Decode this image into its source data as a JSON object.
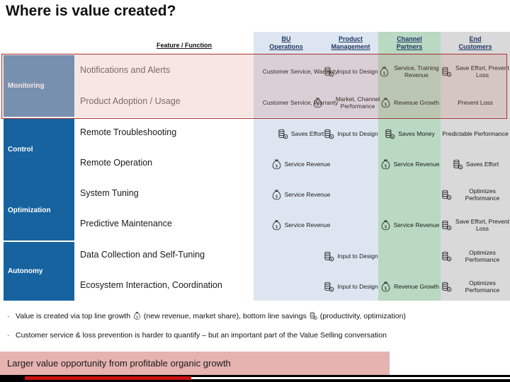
{
  "title": "Where is value created?",
  "feature_column_header": "Feature / Function",
  "columns": [
    {
      "id": "bu",
      "label": "BU\nOperations",
      "label_l1": "BU",
      "label_l2": "Operations",
      "color": "#dde6f0"
    },
    {
      "id": "pm",
      "label": "Product\nManagement",
      "label_l1": "Product",
      "label_l2": "Management",
      "color": "#dde6f0"
    },
    {
      "id": "cp",
      "label": "Channel\nPartners",
      "label_l1": "Channel",
      "label_l2": "Partners",
      "color": "#b9d9c2"
    },
    {
      "id": "ec",
      "label": "End\nCustomers",
      "label_l1": "End",
      "label_l2": "Customers",
      "color": "#d9d9d9"
    }
  ],
  "stages": [
    {
      "label": "Monitoring",
      "color": "#1663a0"
    },
    {
      "label": "Control",
      "color": "#1663a0"
    },
    {
      "label": "Optimization",
      "color": "#1663a0"
    },
    {
      "label": "Autonomy",
      "color": "#1663a0"
    }
  ],
  "rows": [
    {
      "feature": "Notifications and Alerts",
      "cells": [
        {
          "col": "bu",
          "icon": "none",
          "text": "Customer Service, Warranty"
        },
        {
          "col": "pm",
          "icon": "coins-icon",
          "text": "Input to Design"
        },
        {
          "col": "cp",
          "icon": "moneybag-icon",
          "text": "Service, Training Revenue"
        },
        {
          "col": "ec",
          "icon": "coins-icon",
          "text": "Save Effort, Prevent Loss"
        }
      ]
    },
    {
      "feature": "Product Adoption / Usage",
      "cells": [
        {
          "col": "bu",
          "icon": "none",
          "text": "Customer Service, Warranty"
        },
        {
          "col": "pm",
          "icon": "moneybag-icon",
          "text": "Market, Channel Performance"
        },
        {
          "col": "cp",
          "icon": "moneybag-icon",
          "text": "Revenue Growth"
        },
        {
          "col": "ec",
          "icon": "none",
          "text": "Prevent Loss"
        }
      ]
    },
    {
      "feature": "Remote Troubleshooting",
      "cells": [
        {
          "col": "bu",
          "icon": "coins-icon",
          "text": "Saves Effort"
        },
        {
          "col": "pm",
          "icon": "coins-icon",
          "text": "Input to Design"
        },
        {
          "col": "cp",
          "icon": "coins-icon",
          "text": "Saves Money"
        },
        {
          "col": "ec",
          "icon": "none",
          "text": "Predictable Performance"
        }
      ]
    },
    {
      "feature": "Remote Operation",
      "cells": [
        {
          "col": "bu",
          "icon": "moneybag-icon",
          "text": "Service Revenue"
        },
        {
          "col": "pm",
          "icon": "none",
          "text": ""
        },
        {
          "col": "cp",
          "icon": "moneybag-icon",
          "text": "Service Revenue"
        },
        {
          "col": "ec",
          "icon": "coins-icon",
          "text": "Saves Effort"
        }
      ]
    },
    {
      "feature": "System Tuning",
      "cells": [
        {
          "col": "bu",
          "icon": "moneybag-icon",
          "text": "Service Revenue"
        },
        {
          "col": "pm",
          "icon": "none",
          "text": ""
        },
        {
          "col": "cp",
          "icon": "none",
          "text": ""
        },
        {
          "col": "ec",
          "icon": "coins-icon",
          "text": "Optimizes Performance"
        }
      ]
    },
    {
      "feature": "Predictive Maintenance",
      "cells": [
        {
          "col": "bu",
          "icon": "moneybag-icon",
          "text": "Service Revenue"
        },
        {
          "col": "pm",
          "icon": "none",
          "text": ""
        },
        {
          "col": "cp",
          "icon": "moneybag-icon",
          "text": "Service Revenue"
        },
        {
          "col": "ec",
          "icon": "coins-icon",
          "text": "Save Effort, Prevent Loss"
        }
      ]
    },
    {
      "feature": "Data Collection and Self-Tuning",
      "cells": [
        {
          "col": "bu",
          "icon": "none",
          "text": ""
        },
        {
          "col": "pm",
          "icon": "coins-icon",
          "text": "Input to Design"
        },
        {
          "col": "cp",
          "icon": "none",
          "text": ""
        },
        {
          "col": "ec",
          "icon": "coins-icon",
          "text": "Optimizes Performance"
        }
      ]
    },
    {
      "feature": "Ecosystem Interaction, Coordination",
      "cells": [
        {
          "col": "bu",
          "icon": "none",
          "text": ""
        },
        {
          "col": "pm",
          "icon": "coins-icon",
          "text": "Input to Design"
        },
        {
          "col": "cp",
          "icon": "moneybag-icon",
          "text": "Revenue Growth"
        },
        {
          "col": "ec",
          "icon": "coins-icon",
          "text": "Optimizes Performance"
        }
      ]
    }
  ],
  "bullets": [
    {
      "part1": "Value is created via top line growth",
      "icon1": "moneybag-icon",
      "part2": "(new revenue, market share), bottom line savings",
      "icon2": "coins-icon",
      "part3": "(productivity, optimization)"
    },
    {
      "part1": "Customer service & loss prevention is harder to quantify – but an important part of the Value Selling conversation",
      "icon1": "none",
      "part2": "",
      "icon2": "none",
      "part3": ""
    }
  ],
  "banner": {
    "text": "Larger value opportunity from profitable organic growth",
    "color": "#e5b3b0"
  },
  "highlight": {
    "border_color": "#a83232"
  }
}
